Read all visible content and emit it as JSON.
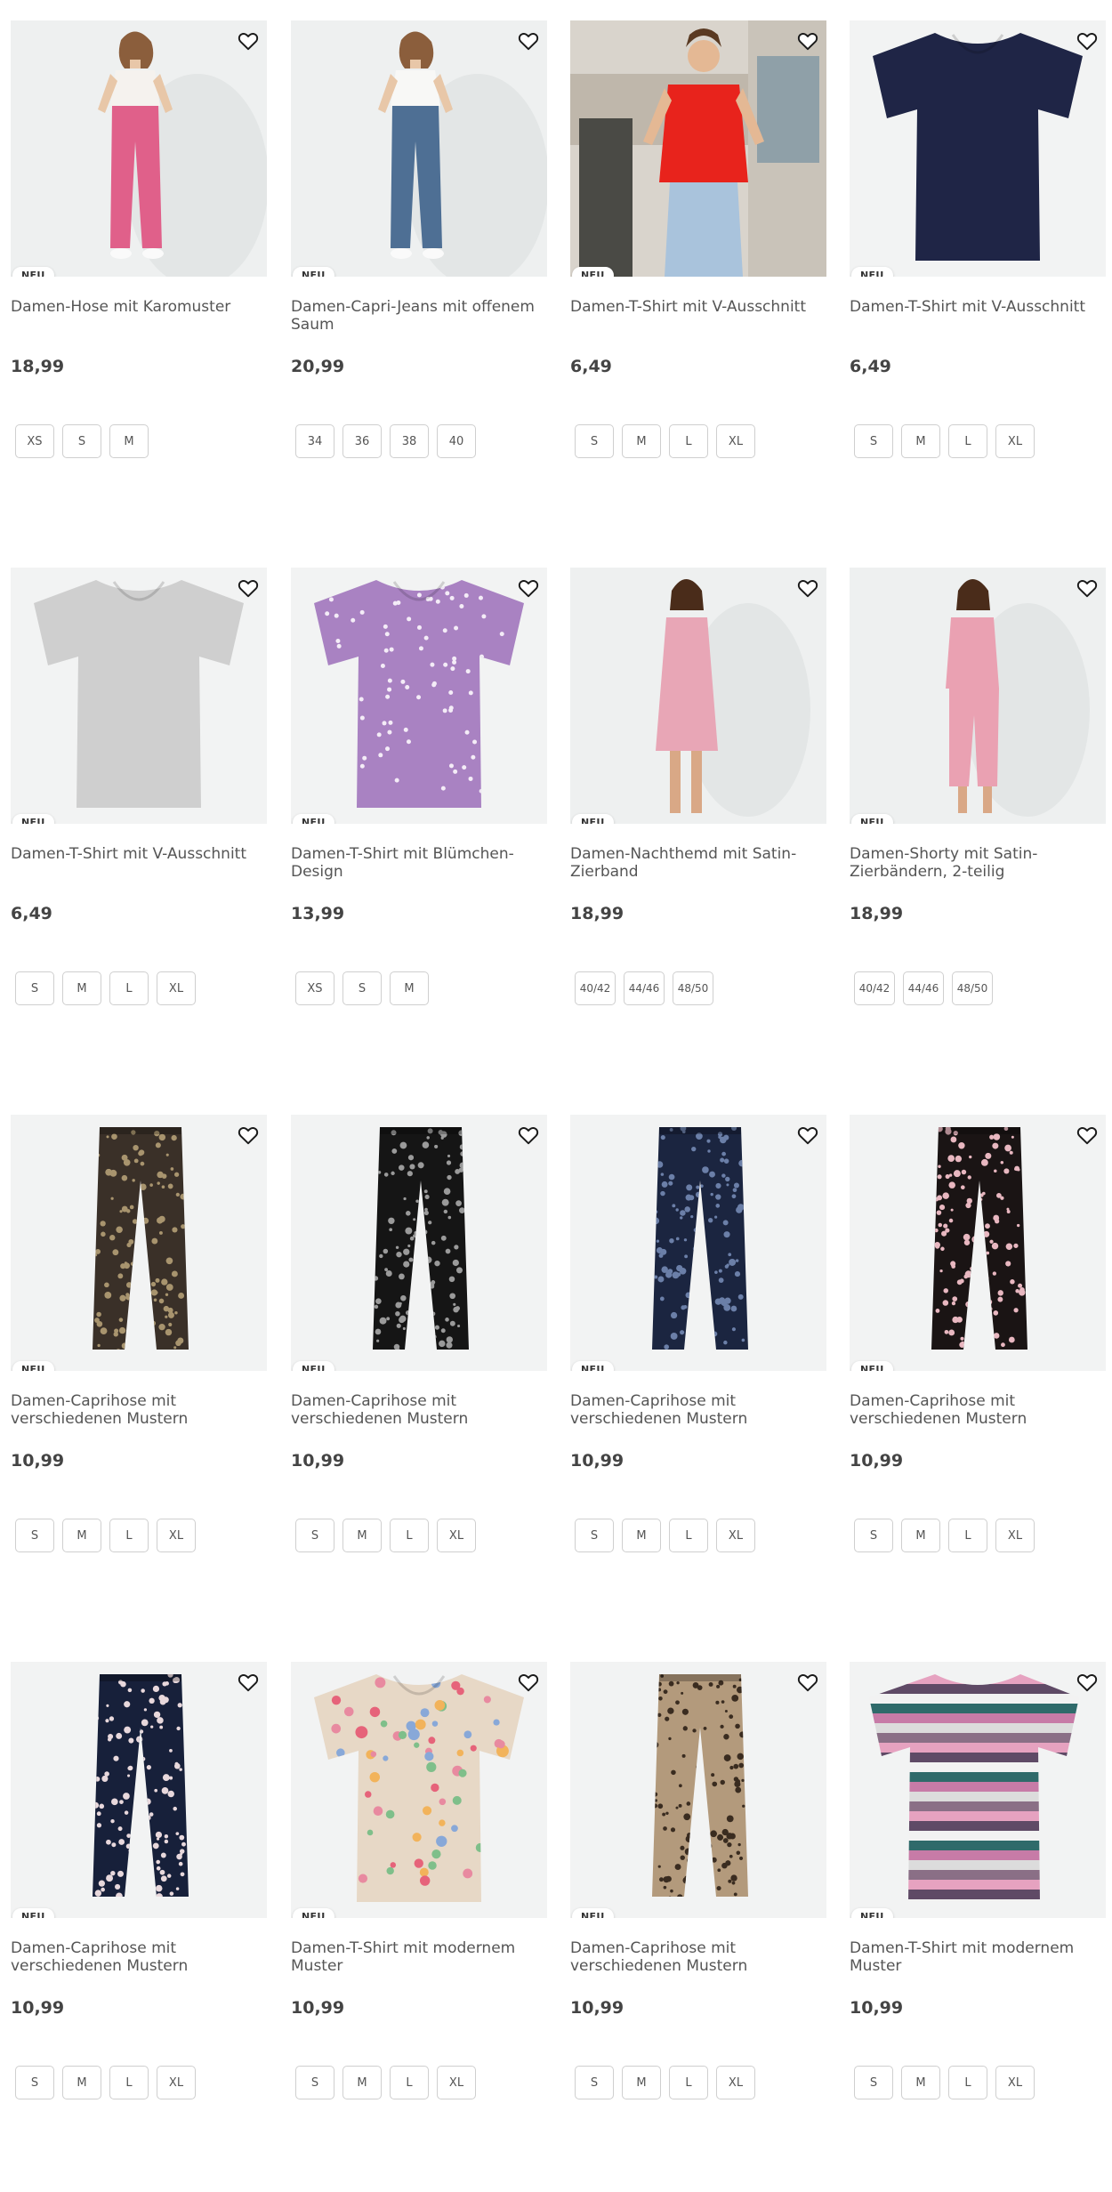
{
  "badge_text": "NEU",
  "products": [
    {
      "title": "Damen-Hose mit Karomuster",
      "price": "18,99",
      "sizes": [
        "XS",
        "S",
        "M"
      ],
      "image": "woman-pink-checked-trousers"
    },
    {
      "title": "Damen-Capri-Jeans mit offenem Saum",
      "price": "20,99",
      "sizes": [
        "34",
        "36",
        "38",
        "40"
      ],
      "image": "woman-blue-capri-jeans"
    },
    {
      "title": "Damen-T-Shirt mit V-Ausschnitt",
      "price": "6,49",
      "sizes": [
        "S",
        "M",
        "L",
        "XL"
      ],
      "image": "woman-red-tshirt"
    },
    {
      "title": "Damen-T-Shirt mit V-Ausschnitt",
      "price": "6,49",
      "sizes": [
        "S",
        "M",
        "L",
        "XL"
      ],
      "image": "navy-tshirt"
    },
    {
      "title": "Damen-T-Shirt mit V-Ausschnitt",
      "price": "6,49",
      "sizes": [
        "S",
        "M",
        "L",
        "XL"
      ],
      "image": "grey-tshirt"
    },
    {
      "title": "Damen-T-Shirt mit Blümchen-Design",
      "price": "13,99",
      "sizes": [
        "XS",
        "S",
        "M"
      ],
      "image": "lilac-floral-tshirt"
    },
    {
      "title": "Damen-Nachthemd mit Satin-Zierband",
      "price": "18,99",
      "sizes": [
        "40/42",
        "44/46",
        "48/50"
      ],
      "image": "woman-pink-nightdress"
    },
    {
      "title": "Damen-Shorty mit Satin-Zierbändern, 2-teilig",
      "price": "18,99",
      "sizes": [
        "40/42",
        "44/46",
        "48/50"
      ],
      "image": "woman-pink-pyjama"
    },
    {
      "title": "Damen-Caprihose mit verschiedenen Mustern",
      "price": "10,99",
      "sizes": [
        "S",
        "M",
        "L",
        "XL"
      ],
      "image": "brown-pattern-capri"
    },
    {
      "title": "Damen-Caprihose mit verschiedenen Mustern",
      "price": "10,99",
      "sizes": [
        "S",
        "M",
        "L",
        "XL"
      ],
      "image": "black-dot-capri"
    },
    {
      "title": "Damen-Caprihose mit verschiedenen Mustern",
      "price": "10,99",
      "sizes": [
        "S",
        "M",
        "L",
        "XL"
      ],
      "image": "navy-dot-capri"
    },
    {
      "title": "Damen-Caprihose mit verschiedenen Mustern",
      "price": "10,99",
      "sizes": [
        "S",
        "M",
        "L",
        "XL"
      ],
      "image": "black-floral-capri"
    },
    {
      "title": "Damen-Caprihose mit verschiedenen Mustern",
      "price": "10,99",
      "sizes": [
        "S",
        "M",
        "L",
        "XL"
      ],
      "image": "navy-floral-capri"
    },
    {
      "title": "Damen-T-Shirt mit modernem Muster",
      "price": "10,99",
      "sizes": [
        "S",
        "M",
        "L",
        "XL"
      ],
      "image": "floral-print-tshirt"
    },
    {
      "title": "Damen-Caprihose mit verschiedenen Mustern",
      "price": "10,99",
      "sizes": [
        "S",
        "M",
        "L",
        "XL"
      ],
      "image": "leopard-capri"
    },
    {
      "title": "Damen-T-Shirt mit modernem Muster",
      "price": "10,99",
      "sizes": [
        "S",
        "M",
        "L",
        "XL"
      ],
      "image": "striped-tshirt"
    }
  ],
  "icons": {
    "favorite": "heart-outline-icon"
  }
}
